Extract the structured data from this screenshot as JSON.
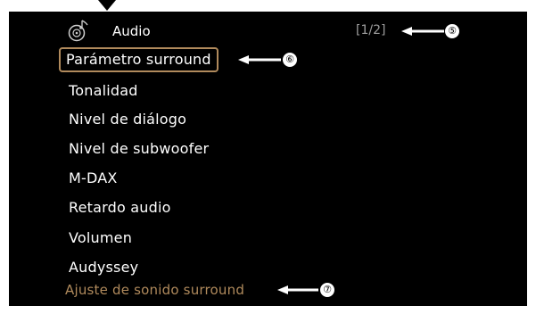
{
  "header": {
    "icon": "speaker-note-icon",
    "title": "Audio",
    "page_indicator": "[1/2]"
  },
  "menu": {
    "items": [
      {
        "label": "Parámetro surround",
        "selected": true
      },
      {
        "label": "Tonalidad"
      },
      {
        "label": "Nivel de diálogo"
      },
      {
        "label": "Nivel de subwoofer"
      },
      {
        "label": "M-DAX"
      },
      {
        "label": "Retardo audio"
      },
      {
        "label": "Volumen"
      },
      {
        "label": "Audyssey"
      }
    ]
  },
  "footer": {
    "description": "Ajuste de sonido surround"
  },
  "callouts": [
    {
      "label": "⑤"
    },
    {
      "label": "⑥"
    },
    {
      "label": "⑦"
    }
  ],
  "colors": {
    "screen_background": "#000000",
    "selection_border": "#b08a5c",
    "footer_text": "#b08a5c",
    "page_indicator": "#9e9e9e"
  }
}
